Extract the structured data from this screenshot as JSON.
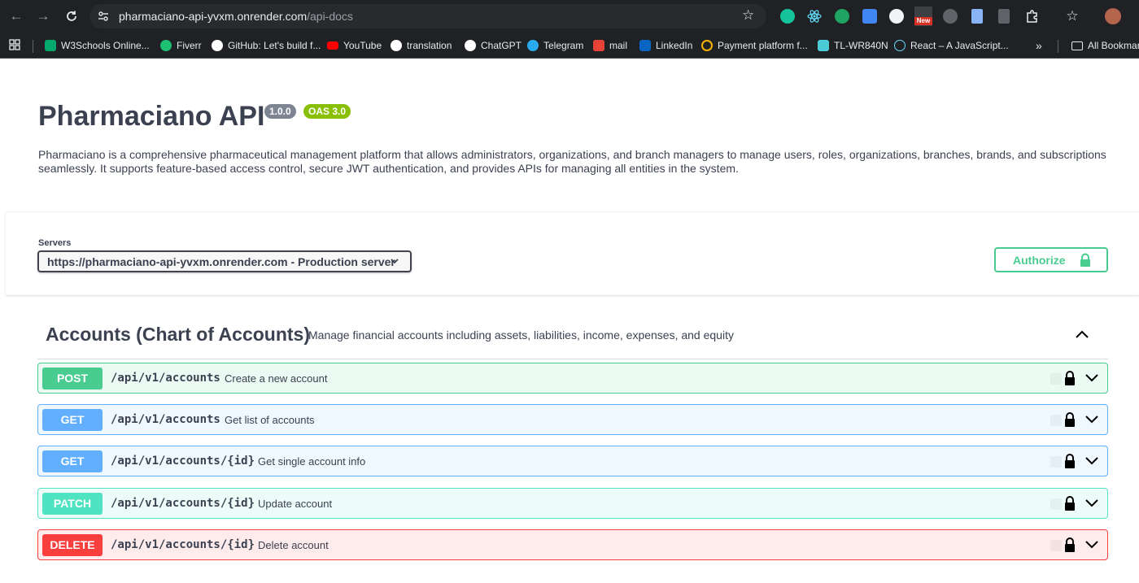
{
  "browser": {
    "url_host": "pharmaciano-api-yvxm.onrender.com",
    "url_path": "/api-docs",
    "extensions": [
      "grammarly-icon",
      "react-devtools-icon",
      "extension-green-icon",
      "google-translate-icon",
      "extension-circle-icon",
      "extension-new-icon",
      "extension-gray-icon",
      "extension-doc-icon",
      "extension-clipboard-icon",
      "extensions-puzzle-icon",
      "bookmark-star-icon",
      "profile-avatar"
    ],
    "new_badge": "New",
    "bookmarks": [
      {
        "label": "W3Schools Online...",
        "icon": "w3schools-icon",
        "color": "#04aa6d"
      },
      {
        "label": "Fiverr",
        "icon": "fiverr-icon",
        "color": "#1dbf73"
      },
      {
        "label": "GitHub: Let's build f...",
        "icon": "github-icon",
        "color": "#ffffff"
      },
      {
        "label": "YouTube",
        "icon": "youtube-icon",
        "color": "#ff0000"
      },
      {
        "label": "translation",
        "icon": "google-icon",
        "color": "#ffffff"
      },
      {
        "label": "ChatGPT",
        "icon": "chatgpt-icon",
        "color": "#ffffff"
      },
      {
        "label": "Telegram",
        "icon": "telegram-icon",
        "color": "#2aabee"
      },
      {
        "label": "mail",
        "icon": "gmail-icon",
        "color": "#ea4335"
      },
      {
        "label": "LinkedIn",
        "icon": "linkedin-icon",
        "color": "#0a66c2"
      },
      {
        "label": "Payment platform f...",
        "icon": "payment-icon",
        "color": "#f4b400"
      },
      {
        "label": "TL-WR840N",
        "icon": "tplink-icon",
        "color": "#4acbd6"
      },
      {
        "label": "React – A JavaScript...",
        "icon": "react-icon",
        "color": "#61dafb"
      }
    ],
    "overflow_label": "»",
    "all_bookmarks": "All Bookmarks"
  },
  "api": {
    "title": "Pharmaciano API",
    "version": "1.0.0",
    "oas": "OAS 3.0",
    "description": "Pharmaciano is a comprehensive pharmaceutical management platform that allows administrators, organizations, and branch managers to manage users, roles, organizations, branches, brands, and subscriptions seamlessly. It supports feature-based access control, secure JWT authentication, and provides APIs for managing all entities in the system."
  },
  "servers": {
    "label": "Servers",
    "selected": "https://pharmaciano-api-yvxm.onrender.com - Production server"
  },
  "authorize": {
    "label": "Authorize"
  },
  "tag": {
    "name": "Accounts (Chart of Accounts)",
    "description": "Manage financial accounts including assets, liabilities, income, expenses, and equity"
  },
  "operations": [
    {
      "method": "POST",
      "path": "/api/v1/accounts",
      "summary": "Create a new account"
    },
    {
      "method": "GET",
      "path": "/api/v1/accounts",
      "summary": "Get list of accounts"
    },
    {
      "method": "GET",
      "path": "/api/v1/accounts/{id}",
      "summary": "Get single account info"
    },
    {
      "method": "PATCH",
      "path": "/api/v1/accounts/{id}",
      "summary": "Update account"
    },
    {
      "method": "DELETE",
      "path": "/api/v1/accounts/{id}",
      "summary": "Delete account"
    }
  ]
}
